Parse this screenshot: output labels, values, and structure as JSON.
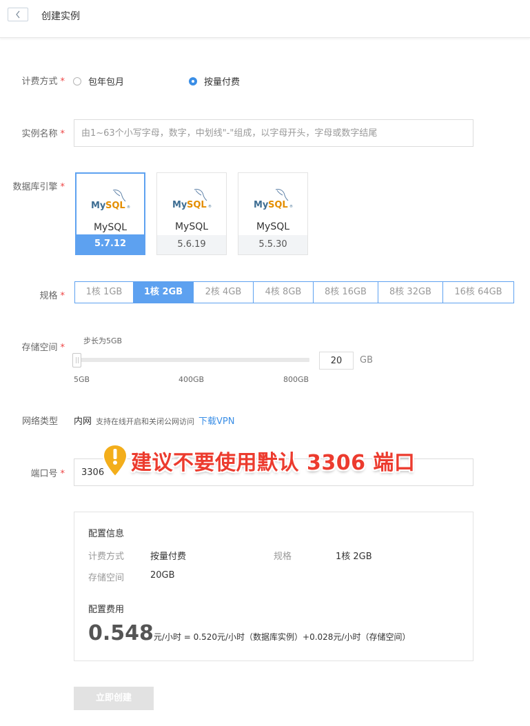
{
  "header": {
    "title": "创建实例"
  },
  "billing": {
    "label": "计费方式",
    "required_mark": "*",
    "options": [
      {
        "label": "包年包月",
        "selected": false
      },
      {
        "label": "按量付费",
        "selected": true
      }
    ]
  },
  "instance_name": {
    "label": "实例名称",
    "required_mark": "*",
    "placeholder": "由1~63个小写字母，数字，中划线\"-\"组成，以字母开头，字母或数字结尾",
    "value": ""
  },
  "engine": {
    "label": "数据库引擎",
    "required_mark": "*",
    "cards": [
      {
        "name": "MySQL",
        "version": "5.7.12",
        "selected": true
      },
      {
        "name": "MySQL",
        "version": "5.6.19",
        "selected": false
      },
      {
        "name": "MySQL",
        "version": "5.5.30",
        "selected": false
      }
    ]
  },
  "spec": {
    "label": "规格",
    "required_mark": "*",
    "options": [
      "1核 1GB",
      "1核 2GB",
      "2核 4GB",
      "4核 8GB",
      "8核 16GB",
      "8核 32GB",
      "16核 64GB"
    ],
    "selected": "1核 2GB"
  },
  "storage": {
    "label": "存储空间",
    "required_mark": "*",
    "step_hint": "步长为5GB",
    "ticks": [
      "5GB",
      "400GB",
      "800GB"
    ],
    "value": "20",
    "unit": "GB",
    "min": 5,
    "max": 800
  },
  "network": {
    "label": "网络类型",
    "value": "内网",
    "hint": "支持在线开启和关闭公网访问",
    "link": "下载VPN"
  },
  "port": {
    "label": "端口号",
    "required_mark": "*",
    "value": "3306"
  },
  "warning": {
    "icon": "exclamation-icon",
    "text": "建议不要使用默认 3306 端口",
    "color": "#ec3b2e"
  },
  "summary": {
    "config_title": "配置信息",
    "billing_key": "计费方式",
    "billing_value": "按量付费",
    "spec_key": "规格",
    "spec_value": "1核 2GB",
    "storage_key": "存储空间",
    "storage_value": "20GB",
    "cost_title": "配置费用",
    "price": "0.548",
    "price_detail": "元/小时 = 0.520元/小时（数据库实例）+0.028元/小时（存储空间）"
  },
  "create_button": {
    "label": "立即创建",
    "enabled": false
  },
  "colors": {
    "accent": "#5da1f0",
    "required": "#e44444",
    "link": "#3a8ee6"
  }
}
